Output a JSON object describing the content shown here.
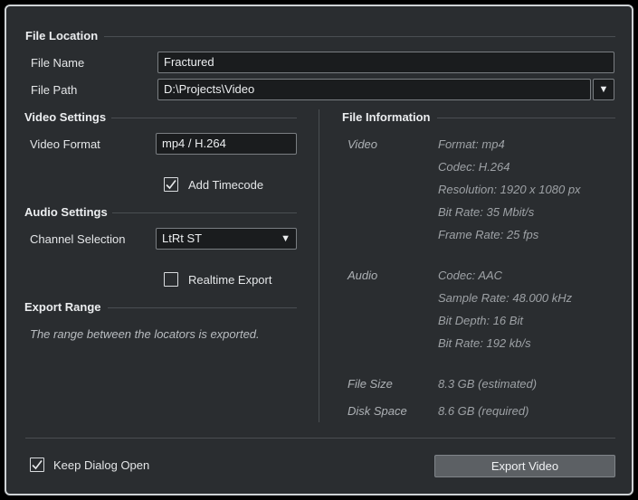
{
  "file_location": {
    "title": "File Location",
    "file_name_label": "File Name",
    "file_name_value": "Fractured",
    "file_path_label": "File Path",
    "file_path_value": "D:\\Projects\\Video"
  },
  "video_settings": {
    "title": "Video Settings",
    "video_format_label": "Video Format",
    "video_format_value": "mp4 / H.264",
    "add_timecode_label": "Add Timecode",
    "add_timecode_checked": true
  },
  "audio_settings": {
    "title": "Audio Settings",
    "channel_selection_label": "Channel Selection",
    "channel_selection_value": "LtRt ST",
    "realtime_export_label": "Realtime Export",
    "realtime_export_checked": false
  },
  "export_range": {
    "title": "Export Range",
    "note": "The range between the locators is exported."
  },
  "file_information": {
    "title": "File Information",
    "video_label": "Video",
    "video_values": [
      "Format: mp4",
      "Codec: H.264",
      "Resolution: 1920 x 1080 px",
      "Bit Rate: 35 Mbit/s",
      "Frame Rate: 25 fps"
    ],
    "audio_label": "Audio",
    "audio_values": [
      "Codec: AAC",
      "Sample Rate: 48.000 kHz",
      "Bit Depth: 16 Bit",
      "Bit Rate: 192 kb/s"
    ],
    "file_size_label": "File Size",
    "file_size_value": "8.3 GB (estimated)",
    "disk_space_label": "Disk Space",
    "disk_space_value": "8.6 GB (required)"
  },
  "footer": {
    "keep_open_label": "Keep Dialog Open",
    "keep_open_checked": true,
    "export_button_label": "Export Video"
  },
  "icons": {
    "dropdown": "triangle-down-icon",
    "check": "checkmark-icon"
  },
  "colors": {
    "background": "#2a2d30",
    "field": "#1a1c1e",
    "border": "#cfd3d6",
    "button": "#5c6064"
  }
}
